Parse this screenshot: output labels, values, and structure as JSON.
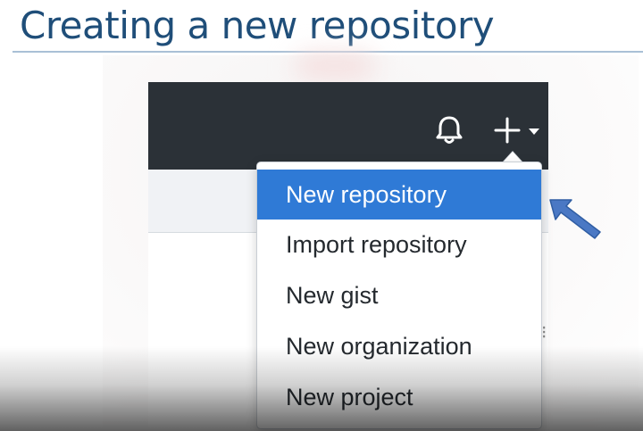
{
  "slide": {
    "title": "Creating a new repository"
  },
  "header": {
    "notifications_icon": "bell-icon",
    "create_menu_icon": "plus-icon",
    "create_menu_caret": "caret-down-icon"
  },
  "dropdown": {
    "items": [
      {
        "label": "New repository",
        "selected": true
      },
      {
        "label": "Import repository",
        "selected": false
      },
      {
        "label": "New gist",
        "selected": false
      },
      {
        "label": "New organization",
        "selected": false
      },
      {
        "label": "New project",
        "selected": false
      }
    ]
  },
  "annotation": {
    "pointer_icon": "arrow-pointer-icon"
  },
  "colors": {
    "title": "#1f4e79",
    "header_bg": "#2b3137",
    "highlight": "#2f7ad6",
    "pointer_arrow": "#4a78c4"
  }
}
